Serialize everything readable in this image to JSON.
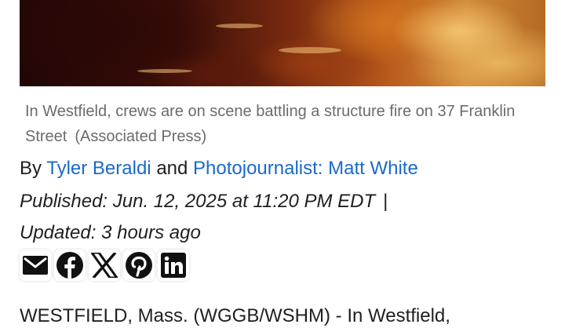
{
  "caption": {
    "text": "In Westfield, crews are on scene battling a structure fire on 37 Franklin Street",
    "credit": "(Associated Press)"
  },
  "byline": {
    "by": "By",
    "author": "Tyler Beraldi",
    "and": "and",
    "photographer": "Photojournalist: Matt White"
  },
  "dates": {
    "published": "Published: Jun. 12, 2025 at 11:20 PM EDT",
    "separator": "|",
    "updated": "Updated: 3 hours ago"
  },
  "share_icons": [
    "email-icon",
    "facebook-icon",
    "x-icon",
    "pinterest-icon",
    "linkedin-icon"
  ],
  "article": {
    "first_line": "WESTFIELD, Mass. (WGGB/WSHM) - In Westfield,"
  },
  "colors": {
    "link": "#1a6ac9",
    "caption": "#6b6b6b",
    "text": "#1f1f1f"
  }
}
